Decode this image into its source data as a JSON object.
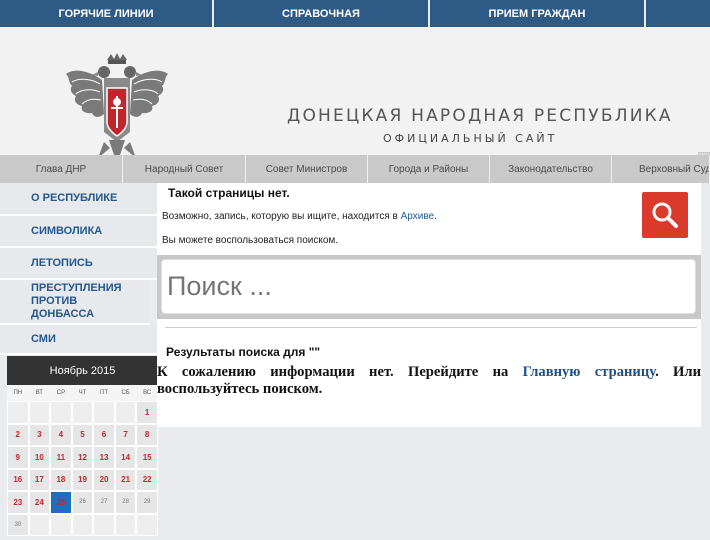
{
  "topnav": [
    {
      "label": "ГОРЯЧИЕ ЛИНИИ"
    },
    {
      "label": "СПРАВОЧНАЯ"
    },
    {
      "label": "ПРИЕМ ГРАЖДАН"
    },
    {
      "label": ""
    }
  ],
  "header": {
    "title": "ДОНЕЦКАЯ НАРОДНАЯ РЕСПУБЛИКА",
    "subtitle": "ОФИЦИАЛЬНЫЙ САЙТ"
  },
  "secnav": [
    {
      "label": "Глава ДНР"
    },
    {
      "label": "Народный Совет"
    },
    {
      "label": "Совет Министров"
    },
    {
      "label": "Города и Районы"
    },
    {
      "label": "Законодательство"
    },
    {
      "label": "Верховный Суд"
    }
  ],
  "sidebar": [
    {
      "label": "О РЕСПУБЛИКЕ"
    },
    {
      "label": "СИМВОЛИКА"
    },
    {
      "label": "ЛЕТОПИСЬ"
    },
    {
      "label": "ПРЕСТУПЛЕНИЯ ПРОТИВ ДОНБАССА"
    },
    {
      "label": "СМИ"
    }
  ],
  "calendar": {
    "month": "Ноябрь 2015",
    "weekdays": [
      "ПН",
      "ВТ",
      "СР",
      "ЧТ",
      "ПТ",
      "СБ",
      "ВС"
    ],
    "first_weekday_index": 6,
    "days_in_month": 30,
    "today": 25,
    "colors": {
      "today": "#1f6fbf",
      "past_day_text": "#c0272d"
    }
  },
  "content": {
    "title": "Такой страницы нет.",
    "line1_prefix": "Возможно, запись, которую вы ищите, находится в ",
    "line1_link": "Архиве",
    "line1_suffix": ".",
    "line2": "Вы можете воспользоваться поиском.",
    "search_placeholder": "Поиск ...",
    "search_icon": "search-icon",
    "results_heading": "Результаты поиска для \"\"",
    "msg_prefix": "К сожалению информации нет. Перейдите на ",
    "msg_link": "Главную страницу",
    "msg_suffix": ". Или воспользуйтесь поиском."
  }
}
